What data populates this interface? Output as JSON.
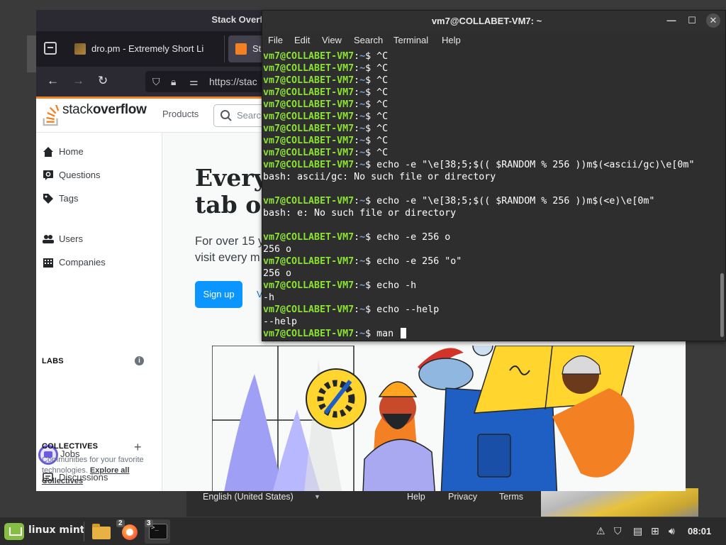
{
  "firefox": {
    "title": "Stack Overflow - Wi",
    "tabs": [
      {
        "label": "dro.pm - Extremely Short Li"
      },
      {
        "label": "Sta"
      }
    ],
    "url": "https://stac"
  },
  "stackoverflow": {
    "logo_text_1": "stack",
    "logo_text_2": "overflow",
    "nav_products": "Products",
    "search_placeholder": "Search",
    "sidebar": {
      "home": "Home",
      "questions": "Questions",
      "tags": "Tags",
      "users": "Users",
      "companies": "Companies",
      "labs_heading": "LABS",
      "jobs": "Jobs",
      "discussions": "Discussions",
      "collectives_heading": "COLLECTIVES",
      "collectives_desc": "Communities for your favorite technologies.",
      "explore_link": "Explore all Collectives"
    },
    "hero": {
      "title": "Every\ntab op",
      "subtitle": "For over 15 y\nvisit every m",
      "signup_button": "Sign up",
      "secondary_link": "V"
    },
    "footer": {
      "language": "English (United States)",
      "help": "Help",
      "privacy": "Privacy",
      "terms": "Terms"
    }
  },
  "terminal": {
    "title": "vm7@COLLABET-VM7: ~",
    "menu": [
      "File",
      "Edit",
      "View",
      "Search",
      "Terminal",
      "Help"
    ],
    "prompt_user": "vm7@COLLABET-VM7",
    "prompt_dir": "~",
    "lines": [
      {
        "type": "cmd",
        "text": "^C"
      },
      {
        "type": "cmd",
        "text": "^C"
      },
      {
        "type": "cmd",
        "text": "^C"
      },
      {
        "type": "cmd",
        "text": "^C"
      },
      {
        "type": "cmd",
        "text": "^C"
      },
      {
        "type": "cmd",
        "text": "^C"
      },
      {
        "type": "cmd",
        "text": "^C"
      },
      {
        "type": "cmd",
        "text": "^C"
      },
      {
        "type": "cmd",
        "text": "^C"
      },
      {
        "type": "cmd",
        "text": "echo -e \"\\e[38;5;$(( $RANDOM % 256 ))m$(<ascii/gc)\\e[0m\""
      },
      {
        "type": "out",
        "text": "bash: ascii/gc: No such file or directory"
      },
      {
        "type": "out",
        "text": ""
      },
      {
        "type": "cmd",
        "text": "echo -e \"\\e[38;5;$(( $RANDOM % 256 ))m$(<e)\\e[0m\""
      },
      {
        "type": "out",
        "text": "bash: e: No such file or directory"
      },
      {
        "type": "out",
        "text": ""
      },
      {
        "type": "cmd",
        "text": "echo -e 256 o"
      },
      {
        "type": "out",
        "text": "256 o"
      },
      {
        "type": "cmd",
        "text": "echo -e 256 \"o\""
      },
      {
        "type": "out",
        "text": "256 o"
      },
      {
        "type": "cmd",
        "text": "echo -h"
      },
      {
        "type": "out",
        "text": "-h"
      },
      {
        "type": "cmd",
        "text": "echo --help"
      },
      {
        "type": "out",
        "text": "--help"
      },
      {
        "type": "current",
        "text": "man "
      }
    ]
  },
  "taskbar": {
    "menu_label": "linux mint",
    "app_badges": {
      "firefox": "2",
      "terminal": "3"
    },
    "clock": "08:01"
  },
  "icons": {
    "taskbar": [
      "mint-logo-icon",
      "files-icon",
      "firefox-icon",
      "terminal-icon"
    ],
    "tray": [
      "update-icon",
      "shield-icon",
      "clipboard-icon",
      "network-icon",
      "volume-icon"
    ]
  }
}
